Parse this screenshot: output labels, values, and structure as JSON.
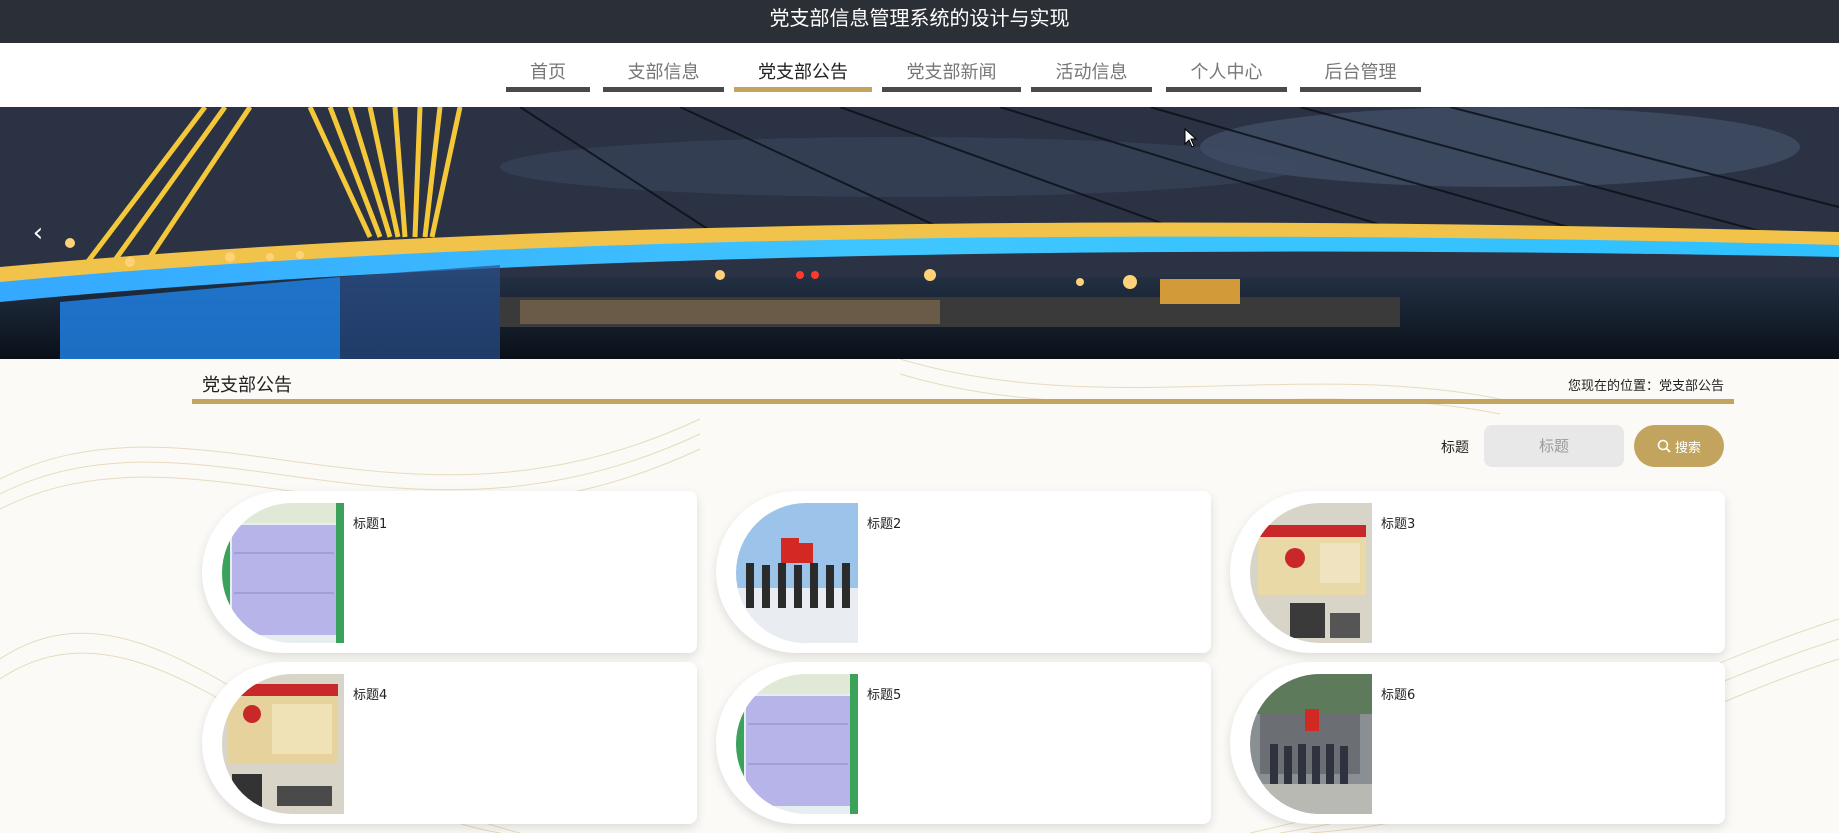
{
  "header": {
    "title": "党支部信息管理系统的设计与实现"
  },
  "nav": {
    "items": [
      {
        "label": "首页"
      },
      {
        "label": "支部信息"
      },
      {
        "label": "党支部公告"
      },
      {
        "label": "党支部新闻"
      },
      {
        "label": "活动信息"
      },
      {
        "label": "个人中心"
      },
      {
        "label": "后台管理"
      }
    ],
    "active_index": 2
  },
  "banner": {
    "prev_icon": "chevron-left-icon"
  },
  "section": {
    "title": "党支部公告",
    "location": "您现在的位置：党支部公告"
  },
  "search": {
    "label": "标题",
    "placeholder": "标题",
    "button_label": "搜索",
    "button_icon": "search-icon"
  },
  "cards": [
    {
      "title": "标题1",
      "image": "bulletin-board-photo"
    },
    {
      "title": "标题2",
      "image": "group-with-flags-photo"
    },
    {
      "title": "标题3",
      "image": "party-room-wall-photo"
    },
    {
      "title": "标题4",
      "image": "party-room-wall-photo"
    },
    {
      "title": "标题5",
      "image": "bulletin-board-photo"
    },
    {
      "title": "标题6",
      "image": "group-at-building-photo"
    }
  ],
  "colors": {
    "accent": "#c3a45e",
    "topbar": "#2b2f36",
    "nav_underline": "#4a4a4a"
  }
}
